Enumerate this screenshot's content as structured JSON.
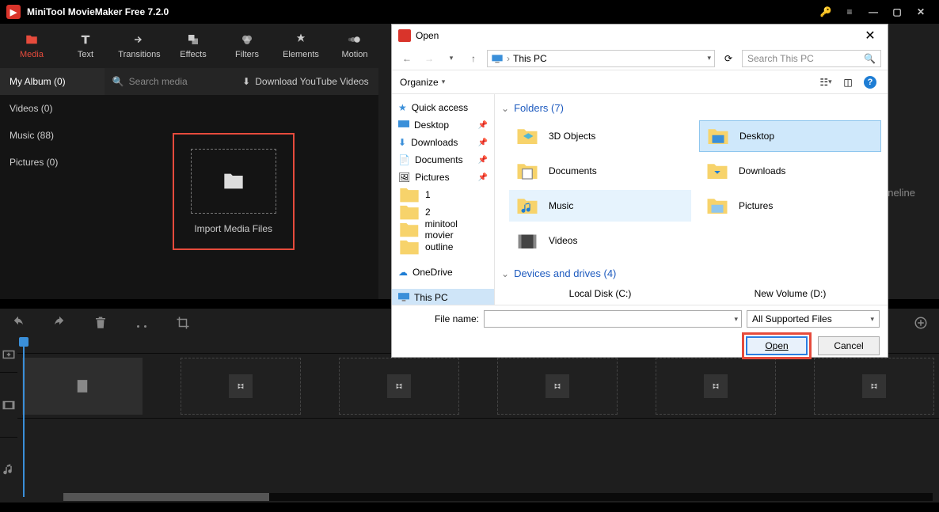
{
  "titlebar": {
    "title": "MiniTool MovieMaker Free 7.2.0"
  },
  "toolbar": {
    "tabs": [
      {
        "label": "Media"
      },
      {
        "label": "Text"
      },
      {
        "label": "Transitions"
      },
      {
        "label": "Effects"
      },
      {
        "label": "Filters"
      },
      {
        "label": "Elements"
      },
      {
        "label": "Motion"
      }
    ]
  },
  "sidebar": {
    "album": "My Album (0)",
    "items": [
      {
        "label": "Videos (0)"
      },
      {
        "label": "Music (88)"
      },
      {
        "label": "Pictures (0)"
      }
    ]
  },
  "media": {
    "search_placeholder": "Search media",
    "download_label": "Download YouTube Videos",
    "import_label": "Import Media Files",
    "timeline_hint": "ineline"
  },
  "dialog": {
    "title": "Open",
    "location": "This PC",
    "search_placeholder": "Search This PC",
    "organize": "Organize",
    "tree": {
      "quick_access": "Quick access",
      "desktop": "Desktop",
      "downloads": "Downloads",
      "documents": "Documents",
      "pictures": "Pictures",
      "f1": "1",
      "f2": "2",
      "mt": "minitool movier",
      "outline": "outline",
      "onedrive": "OneDrive",
      "thispc": "This PC"
    },
    "sections": {
      "folders": "Folders (7)",
      "devices": "Devices and drives (4)"
    },
    "folders": [
      {
        "label": "3D Objects"
      },
      {
        "label": "Desktop"
      },
      {
        "label": "Documents"
      },
      {
        "label": "Downloads"
      },
      {
        "label": "Music"
      },
      {
        "label": "Pictures"
      },
      {
        "label": "Videos"
      }
    ],
    "drives": [
      {
        "label": "Local Disk (C:)"
      },
      {
        "label": "New Volume (D:)"
      }
    ],
    "file_name_label": "File name:",
    "file_type": "All Supported Files",
    "open_btn": "Open",
    "cancel_btn": "Cancel"
  }
}
